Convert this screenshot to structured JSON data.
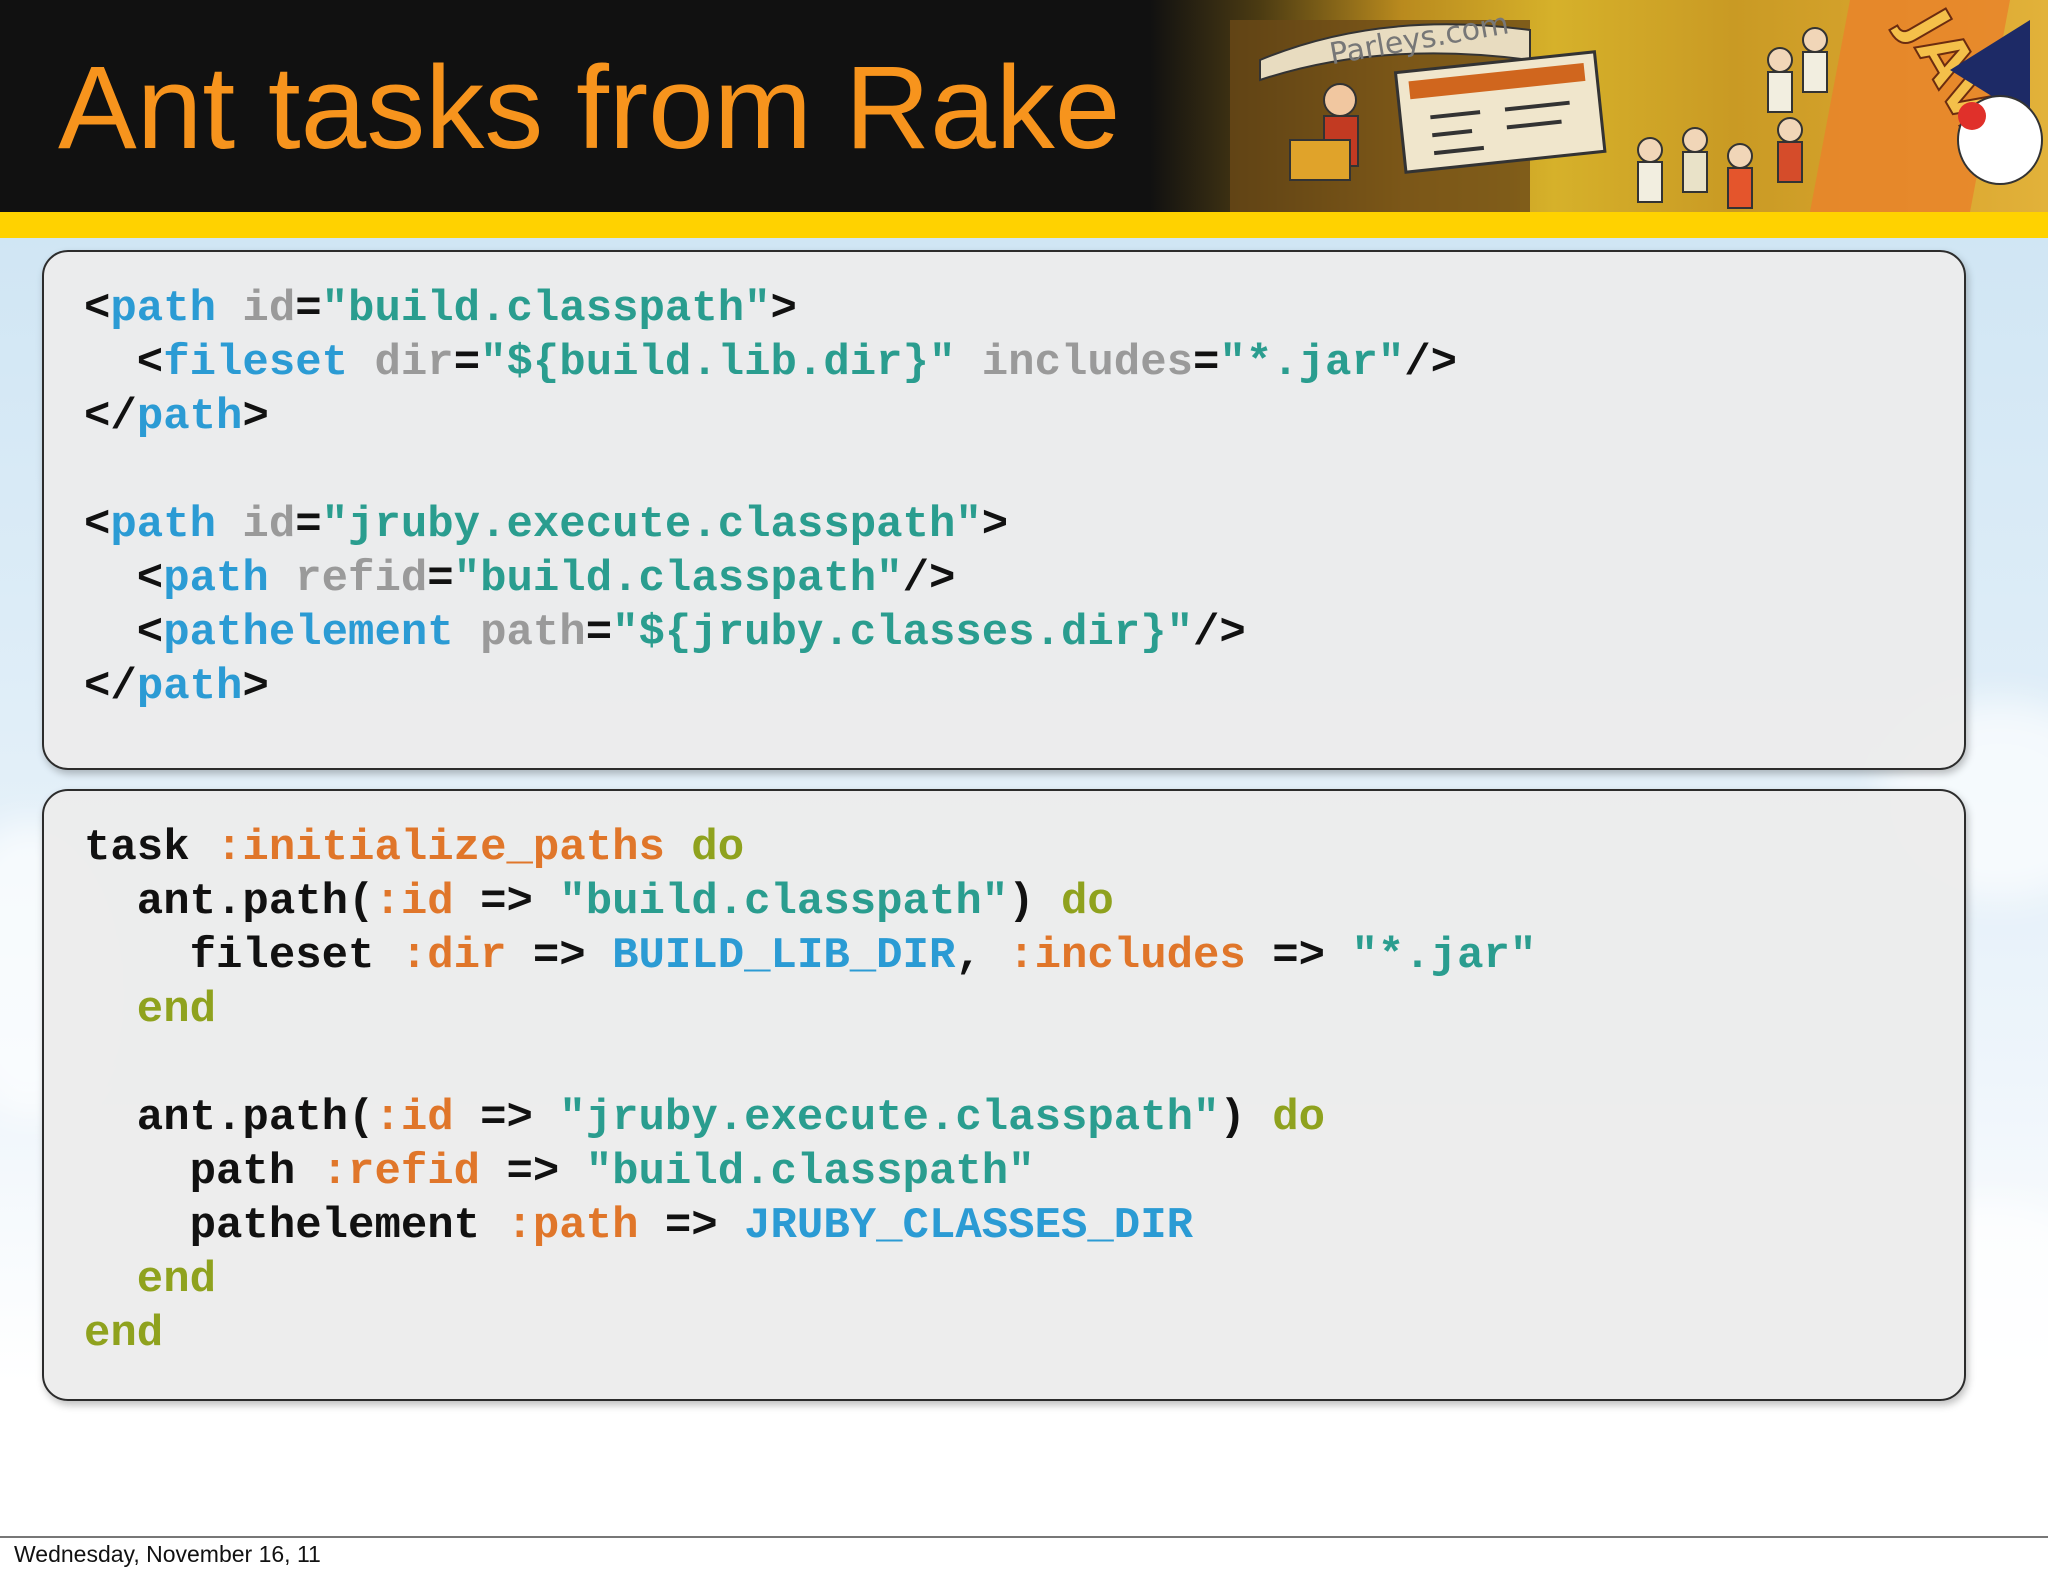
{
  "slide": {
    "title": "Ant tasks from Rake",
    "banner": {
      "sign_text": "Parleys.com",
      "badge_text": "JAVA"
    }
  },
  "code_blocks": [
    {
      "lines": [
        [
          [
            "punct",
            "<"
          ],
          [
            "tag",
            "path"
          ],
          [
            "attr",
            " id"
          ],
          [
            "punct",
            "="
          ],
          [
            "str",
            "\"build.classpath\""
          ],
          [
            "punct",
            ">"
          ]
        ],
        [
          [
            "punct",
            "  <"
          ],
          [
            "tag",
            "fileset"
          ],
          [
            "attr",
            " dir"
          ],
          [
            "punct",
            "="
          ],
          [
            "str",
            "\"${build.lib.dir}\""
          ],
          [
            "attr",
            " includes"
          ],
          [
            "punct",
            "="
          ],
          [
            "str",
            "\"*.jar\""
          ],
          [
            "punct",
            "/>"
          ]
        ],
        [
          [
            "punct",
            "</"
          ],
          [
            "tag",
            "path"
          ],
          [
            "punct",
            ">"
          ]
        ],
        [],
        [
          [
            "punct",
            "<"
          ],
          [
            "tag",
            "path"
          ],
          [
            "attr",
            " id"
          ],
          [
            "punct",
            "="
          ],
          [
            "str",
            "\"jruby.execute.classpath\""
          ],
          [
            "punct",
            ">"
          ]
        ],
        [
          [
            "punct",
            "  <"
          ],
          [
            "tag",
            "path"
          ],
          [
            "attr",
            " refid"
          ],
          [
            "punct",
            "="
          ],
          [
            "str",
            "\"build.classpath\""
          ],
          [
            "punct",
            "/>"
          ]
        ],
        [
          [
            "punct",
            "  <"
          ],
          [
            "tag",
            "pathelement"
          ],
          [
            "attr",
            " path"
          ],
          [
            "punct",
            "="
          ],
          [
            "str",
            "\"${jruby.classes.dir}\""
          ],
          [
            "punct",
            "/>"
          ]
        ],
        [
          [
            "punct",
            "</"
          ],
          [
            "tag",
            "path"
          ],
          [
            "punct",
            ">"
          ]
        ]
      ]
    },
    {
      "lines": [
        [
          [
            "punct",
            "task "
          ],
          [
            "sym",
            ":initialize_paths"
          ],
          [
            "kw",
            " do"
          ]
        ],
        [
          [
            "punct",
            "  ant.path("
          ],
          [
            "sym",
            ":id"
          ],
          [
            "punct",
            " => "
          ],
          [
            "str",
            "\"build.classpath\""
          ],
          [
            "punct",
            ") "
          ],
          [
            "kw",
            "do"
          ]
        ],
        [
          [
            "punct",
            "    fileset "
          ],
          [
            "sym",
            ":dir"
          ],
          [
            "punct",
            " => "
          ],
          [
            "const",
            "BUILD_LIB_DIR"
          ],
          [
            "punct",
            ", "
          ],
          [
            "sym",
            ":includes"
          ],
          [
            "punct",
            " => "
          ],
          [
            "str",
            "\"*.jar\""
          ]
        ],
        [
          [
            "kw",
            "  end"
          ]
        ],
        [],
        [
          [
            "punct",
            "  ant.path("
          ],
          [
            "sym",
            ":id"
          ],
          [
            "punct",
            " => "
          ],
          [
            "str",
            "\"jruby.execute.classpath\""
          ],
          [
            "punct",
            ") "
          ],
          [
            "kw",
            "do"
          ]
        ],
        [
          [
            "punct",
            "    path "
          ],
          [
            "sym",
            ":refid"
          ],
          [
            "punct",
            " => "
          ],
          [
            "str",
            "\"build.classpath\""
          ]
        ],
        [
          [
            "punct",
            "    pathelement "
          ],
          [
            "sym",
            ":path"
          ],
          [
            "punct",
            " => "
          ],
          [
            "const",
            "JRUBY_CLASSES_DIR"
          ]
        ],
        [
          [
            "kw",
            "  end"
          ]
        ],
        [
          [
            "kw",
            "end"
          ]
        ]
      ]
    }
  ],
  "footer": {
    "date": "Wednesday, November 16, 11"
  },
  "colors": {
    "title": "#f7941d",
    "header_bg": "#111111",
    "accent_rule": "#ffd200",
    "xml_tag": "#2b9bd4",
    "xml_attr": "#9a9a9a",
    "string": "#2a9d8f",
    "symbol": "#e0762a",
    "keyword": "#8fa21e",
    "constant": "#2b9bd4"
  }
}
